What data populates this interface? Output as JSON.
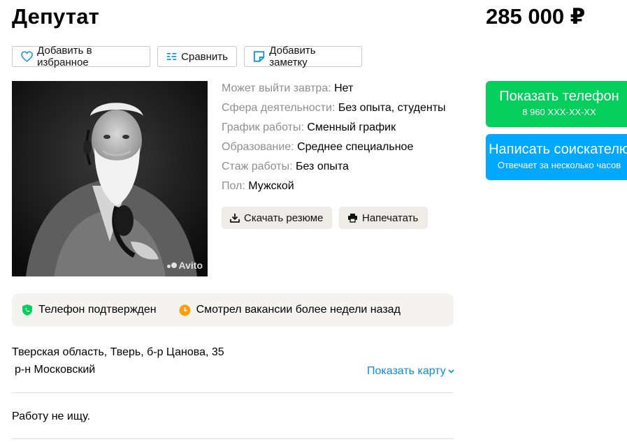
{
  "header": {
    "title": "Депутат",
    "price": "285 000 ₽"
  },
  "actions": {
    "favorite_label": "Добавить в избранное",
    "compare_label": "Сравнить",
    "note_label": "Добавить заметку"
  },
  "photo": {
    "watermark": "Avito"
  },
  "params": [
    {
      "key": "Может выйти завтра: ",
      "value": "Нет"
    },
    {
      "key": "Сфера деятельности: ",
      "value": "Без опыта, студенты"
    },
    {
      "key": "График работы: ",
      "value": "Сменный график"
    },
    {
      "key": "Образование: ",
      "value": "Среднее специальное"
    },
    {
      "key": "Стаж работы: ",
      "value": "Без опыта"
    },
    {
      "key": "Пол: ",
      "value": "Мужской"
    }
  ],
  "resume_actions": {
    "download_label": "Скачать резюме",
    "print_label": "Напечатать"
  },
  "contact": {
    "phone_button": "Показать телефон",
    "phone_masked": "8 960 XXX-XX-XX",
    "message_button": "Написать соискателю",
    "message_sub": "Отвечает за несколько часов",
    "phone_color": "#04cf5d",
    "message_color": "#00a8ff"
  },
  "badges": {
    "phone_verified": "Телефон подтвержден",
    "last_seen": "Смотрел вакансии более недели назад"
  },
  "location": {
    "address": "Тверская область, Тверь, б-р Цанова, 35",
    "district": "р-н Московский",
    "map_link": "Показать карту"
  },
  "description": "Работу не ищу."
}
